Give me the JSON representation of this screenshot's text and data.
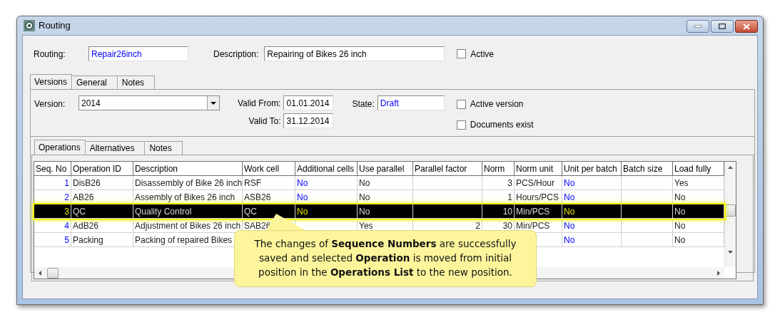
{
  "window": {
    "title": "Routing"
  },
  "header": {
    "routing_label": "Routing:",
    "routing_value": "Repair26inch",
    "description_label": "Description:",
    "description_value": "Repairing of Bikes 26 inch",
    "active": {
      "label": "Active",
      "checked": false
    }
  },
  "tabs": [
    {
      "label": "Versions",
      "selected": true
    },
    {
      "label": "General",
      "selected": false
    },
    {
      "label": "Notes",
      "selected": false
    }
  ],
  "version": {
    "version_label": "Version:",
    "version_value": "2014",
    "valid_from_label": "Valid From:",
    "valid_from": "01.01.2014",
    "valid_to_label": "Valid To:",
    "valid_to": "31.12.2014",
    "state_label": "State:",
    "state_value": "Draft",
    "checkboxes": [
      {
        "label": "Active version",
        "checked": false
      },
      {
        "label": "Documents exist",
        "checked": false
      }
    ]
  },
  "inner_tabs": [
    {
      "label": "Operations",
      "selected": true
    },
    {
      "label": "Alternatives",
      "selected": false
    },
    {
      "label": "Notes",
      "selected": false
    }
  ],
  "table": {
    "columns": [
      {
        "label": "Seq. No",
        "kind": "link"
      },
      {
        "label": "Operation ID",
        "kind": "text"
      },
      {
        "label": "Description",
        "kind": "text"
      },
      {
        "label": "Work cell",
        "kind": "text"
      },
      {
        "label": "Additional cells",
        "kind": "link"
      },
      {
        "label": "Use parallel",
        "kind": "text"
      },
      {
        "label": "Parallel factor",
        "kind": "number"
      },
      {
        "label": "Norm",
        "kind": "number"
      },
      {
        "label": "Norm unit",
        "kind": "text"
      },
      {
        "label": "Unit per batch",
        "kind": "link"
      },
      {
        "label": "Batch size",
        "kind": "text"
      },
      {
        "label": "Load fully",
        "kind": "text"
      }
    ],
    "rows": [
      {
        "selected": false,
        "cells": [
          "1",
          "DisB26",
          "Disassembly of Bike 26 inch",
          "RSF",
          "No",
          "No",
          null,
          "3",
          "PCS/Hour",
          "No",
          null,
          "Yes"
        ]
      },
      {
        "selected": false,
        "cells": [
          "2",
          "AB26",
          "Assembly of Bikes 26 inch",
          "ASB26",
          "No",
          "No",
          null,
          "1",
          "Hours/PCS",
          "No",
          null,
          "No"
        ]
      },
      {
        "selected": true,
        "cells": [
          "3",
          "QC",
          "Quality Control",
          "QC",
          "No",
          "No",
          null,
          "10",
          "Min/PCS",
          "No",
          null,
          "No"
        ]
      },
      {
        "selected": false,
        "cells": [
          "4",
          "AdB26",
          "Adjustment of Bikes 26 inch",
          "SAB26",
          null,
          "Yes",
          "2",
          "30",
          "Min/PCS",
          "No",
          null,
          "No"
        ]
      },
      {
        "selected": false,
        "cells": [
          "5",
          "Packing",
          "Packing of repaired Bikes",
          null,
          null,
          null,
          null,
          null,
          null,
          "No",
          null,
          "No"
        ]
      }
    ]
  },
  "callout": {
    "text": "The changes of **Sequence Numbers** are successfully saved and selected **Operation** is moved from initial position in the **Operations List**  to the new position."
  }
}
